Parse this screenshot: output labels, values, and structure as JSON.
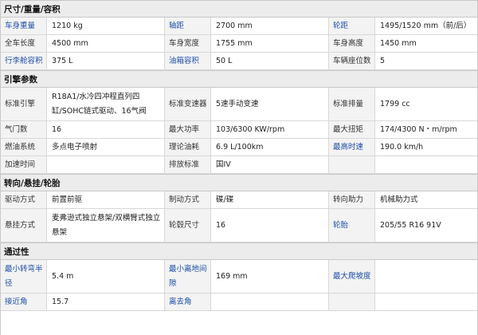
{
  "sections": [
    {
      "title": "尺寸/重量/容积",
      "rows": [
        {
          "height": 0,
          "cells": [
            {
              "label": "车身重量",
              "link": true
            },
            {
              "value": "1210 kg"
            },
            {
              "label": "轴距",
              "link": true
            },
            {
              "value": "2700 mm"
            },
            {
              "label": "轮距",
              "link": true
            },
            {
              "value": "1495/1520 mm（前/后）"
            }
          ]
        },
        {
          "cells": [
            {
              "label": "全车长度"
            },
            {
              "value": "4500 mm"
            },
            {
              "label": "车身宽度"
            },
            {
              "value": "1755 mm"
            },
            {
              "label": "车身高度"
            },
            {
              "value": "1450 mm"
            }
          ]
        },
        {
          "cells": [
            {
              "label": "行李舱容积",
              "link": true
            },
            {
              "value": "375 L"
            },
            {
              "label": "油箱容积",
              "link": true
            },
            {
              "value": "50 L"
            },
            {
              "label": "车辆座位数"
            },
            {
              "value": "5"
            }
          ]
        }
      ]
    },
    {
      "title": "引擎参数",
      "rows": [
        {
          "cells": [
            {
              "label": "标准引擎"
            },
            {
              "value": "R18A1/水冷四冲程直列四缸/SOHC链式驱动、16气阀"
            },
            {
              "label": "标准变速器"
            },
            {
              "value": "5速手动变速"
            },
            {
              "label": "标准排量"
            },
            {
              "value": "1799 cc"
            }
          ]
        },
        {
          "cells": [
            {
              "label": "气门数"
            },
            {
              "value": "16"
            },
            {
              "label": "最大功率"
            },
            {
              "value": "103/6300 KW/rpm"
            },
            {
              "label": "最大扭矩"
            },
            {
              "value": "174/4300 N・m/rpm"
            }
          ]
        },
        {
          "cells": [
            {
              "label": "燃油系统"
            },
            {
              "value": "多点电子喷射"
            },
            {
              "label": "理论油耗"
            },
            {
              "value": "6.9 L/100km"
            },
            {
              "label": "最高时速",
              "link": true
            },
            {
              "value": "190.0 km/h"
            }
          ]
        },
        {
          "cells": [
            {
              "label": "加速时间"
            },
            {
              "value": ""
            },
            {
              "label": "排放标准"
            },
            {
              "value": "国IV"
            },
            {
              "label": ""
            },
            {
              "value": ""
            }
          ]
        }
      ]
    },
    {
      "title": "转向/悬挂/轮胎",
      "rows": [
        {
          "cells": [
            {
              "label": "驱动方式"
            },
            {
              "value": "前置前驱"
            },
            {
              "label": "制动方式"
            },
            {
              "value": "碟/碟"
            },
            {
              "label": "转向助力"
            },
            {
              "value": "机械助力式"
            }
          ]
        },
        {
          "cells": [
            {
              "label": "悬挂方式"
            },
            {
              "value": "麦弗逊式独立悬架/双横臂式独立悬架"
            },
            {
              "label": "轮毂尺寸"
            },
            {
              "value": "16"
            },
            {
              "label": "轮胎",
              "link": true
            },
            {
              "value": "205/55 R16 91V"
            }
          ]
        }
      ]
    },
    {
      "title": "通过性",
      "rows": [
        {
          "cells": [
            {
              "label": "最小转弯半径",
              "link": true
            },
            {
              "value": "5.4 m"
            },
            {
              "label": "最小离地间隙",
              "link": true
            },
            {
              "value": "169 mm"
            },
            {
              "label": "最大爬坡度",
              "link": true
            },
            {
              "value": ""
            }
          ]
        },
        {
          "cells": [
            {
              "label": "接近角",
              "link": true
            },
            {
              "value": "15.7"
            },
            {
              "label": "离去角",
              "link": true
            },
            {
              "value": ""
            },
            {
              "label": ""
            },
            {
              "value": ""
            }
          ]
        }
      ]
    }
  ]
}
